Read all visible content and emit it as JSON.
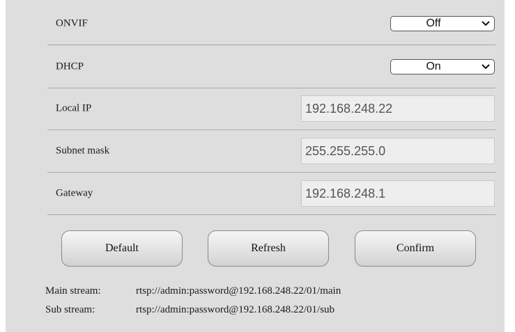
{
  "settings": {
    "onvif": {
      "label": "ONVIF",
      "value": "Off"
    },
    "dhcp": {
      "label": "DHCP",
      "value": "On"
    },
    "local_ip": {
      "label": "Local IP",
      "value": "192.168.248.22"
    },
    "subnet_mask": {
      "label": "Subnet mask",
      "value": "255.255.255.0"
    },
    "gateway": {
      "label": "Gateway",
      "value": "192.168.248.1"
    }
  },
  "buttons": {
    "default": "Default",
    "refresh": "Refresh",
    "confirm": "Confirm"
  },
  "streams": {
    "main": {
      "label": "Main stream:",
      "url": "rtsp://admin:password@192.168.248.22/01/main"
    },
    "sub": {
      "label": "Sub stream:",
      "url": "rtsp://admin:password@192.168.248.22/01/sub"
    }
  },
  "icons": {
    "dropdown": "chevron-down-icon"
  }
}
